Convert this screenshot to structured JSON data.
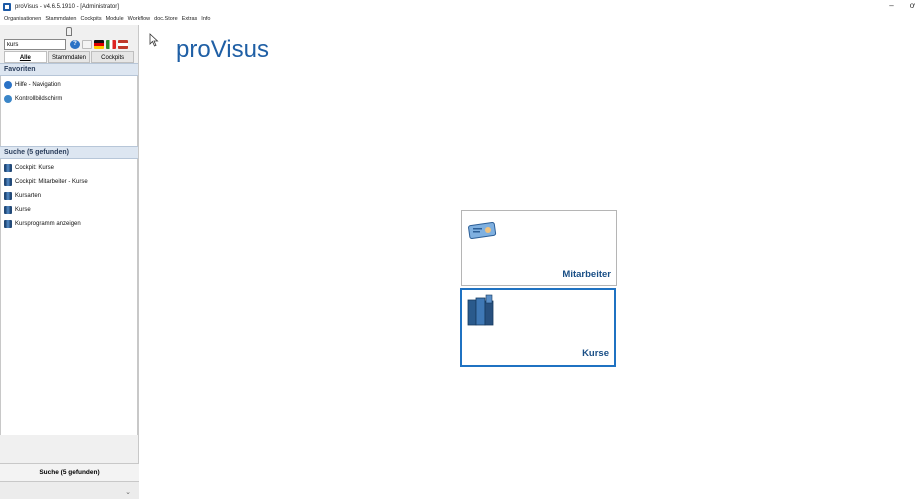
{
  "window": {
    "title": "proVisus - v4.6.5.1910 - [Administrator]",
    "controls": [
      "–",
      "ơ"
    ]
  },
  "menubar": {
    "items": [
      "Organisationen",
      "Stammdaten",
      "Cockpits",
      "Module",
      "Workflow",
      "doc.Store",
      "Extras",
      "Info"
    ]
  },
  "sidebar": {
    "search": {
      "value": "kurs"
    },
    "tabs": [
      "Alle",
      "Stammdaten",
      "Cockpits"
    ],
    "favorites": {
      "title": "Favoriten",
      "items": [
        "Hilfe - Navigation",
        "Kontrollbildschirm"
      ]
    },
    "search_results": {
      "title": "Suche (5 gefunden)",
      "items": [
        "Cockpit: Kurse",
        "Cockpit: Mitarbeiter - Kurse",
        "Kursarten",
        "Kurse",
        "Kursprogramm anzeigen"
      ]
    },
    "bottom_button": "Suche (5 gefunden)"
  },
  "main": {
    "brand": "proVisus",
    "tiles": [
      {
        "label": "Mitarbeiter",
        "icon": "id-card-icon"
      },
      {
        "label": "Kurse",
        "icon": "books-icon"
      }
    ]
  },
  "colors": {
    "brand": "#1f5fa5",
    "accent_border": "#1f72c2",
    "section_header": "#dde6f1"
  }
}
